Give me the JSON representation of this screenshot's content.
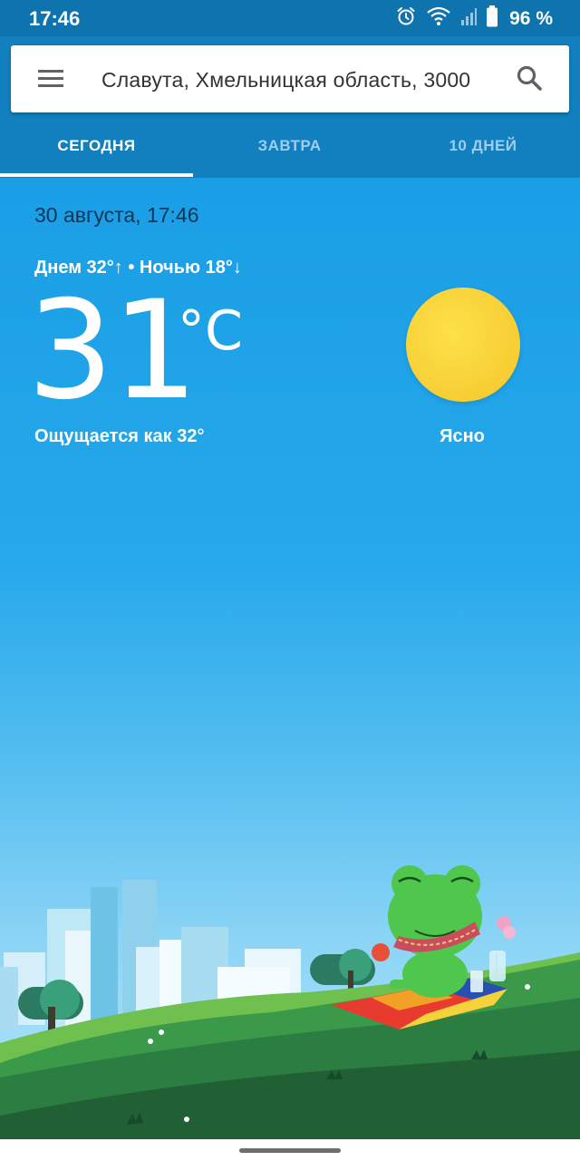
{
  "status_bar": {
    "time": "17:46",
    "battery": "96 %",
    "icons": [
      "alarm-icon",
      "wifi-icon",
      "cell-signal-icon",
      "battery-icon"
    ]
  },
  "search": {
    "location": "Славута, Хмельницкая область, 3000",
    "menu_icon": "menu-icon",
    "search_icon": "search-icon"
  },
  "tabs": [
    {
      "label": "СЕГОДНЯ",
      "selected": true
    },
    {
      "label": "ЗАВТРА",
      "selected": false
    },
    {
      "label": "10 ДНЕЙ",
      "selected": false
    }
  ],
  "weather": {
    "date_time": "30 августа, 17:46",
    "day_night": "Днем 32°↑ • Ночью 18°↓",
    "temperature": "31",
    "unit": "°C",
    "feels_like": "Ощущается как 32°",
    "condition": "Ясно",
    "condition_icon": "sun-icon"
  },
  "colors": {
    "status_bar": "#0f74ad",
    "header": "#1280bf",
    "sky_top": "#1a9ee5",
    "sun": "#f7ce33"
  }
}
